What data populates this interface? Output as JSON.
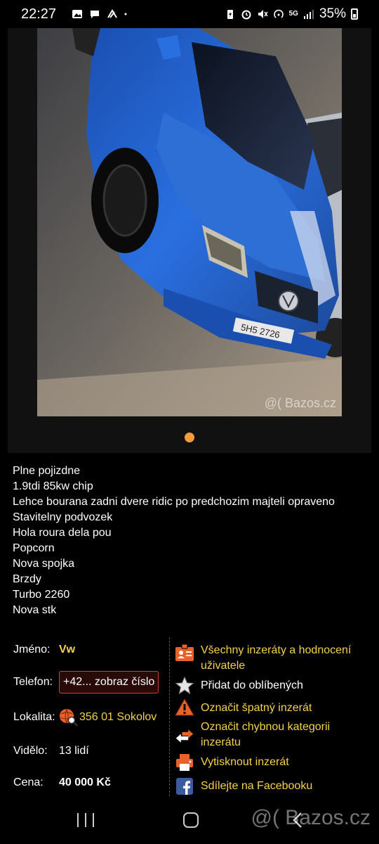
{
  "status_bar": {
    "time": "22:27",
    "network": "5G",
    "battery": "35%"
  },
  "gallery": {
    "watermark": "@( Bazos.cz",
    "plate_text": "5H5 2726",
    "active_dot_color": "#f39b3a"
  },
  "description": {
    "lines": [
      "Plne pojizdne",
      "1.9tdi 85kw chip",
      "Lehce bourana zadni dvere ridic po predchozim majteli opraveno",
      "Stavitelny podvozek",
      "Hola roura dela pou",
      "Popcorn",
      "Nova spojka",
      "Brzdy",
      "Turbo 2260",
      "Nova stk"
    ]
  },
  "details": {
    "name_label": "Jméno:",
    "name_value": "Vw",
    "phone_label": "Telefon:",
    "phone_button": "+42... zobraz číslo",
    "location_label": "Lokalita:",
    "location_value": "356 01 Sokolov",
    "views_label": "Vidělo:",
    "views_value": "13 lidí",
    "price_label": "Cena:",
    "price_value": "40 000 Kč"
  },
  "actions": {
    "all_ads": "Všechny inzeráty a hodnocení uživatele",
    "favorite": "Přidat do oblíbených",
    "report_bad": "Označit špatný inzerát",
    "report_category": "Označit chybnou kategorii inzerátu",
    "print": "Vytisknout inzerát",
    "facebook": "Sdílejte na Facebooku"
  },
  "navbar": {
    "watermark": "@( Bazos.cz"
  },
  "colors": {
    "accent_yellow": "#f5d14a",
    "accent_orange": "#f39b3a",
    "background": "#000000"
  }
}
